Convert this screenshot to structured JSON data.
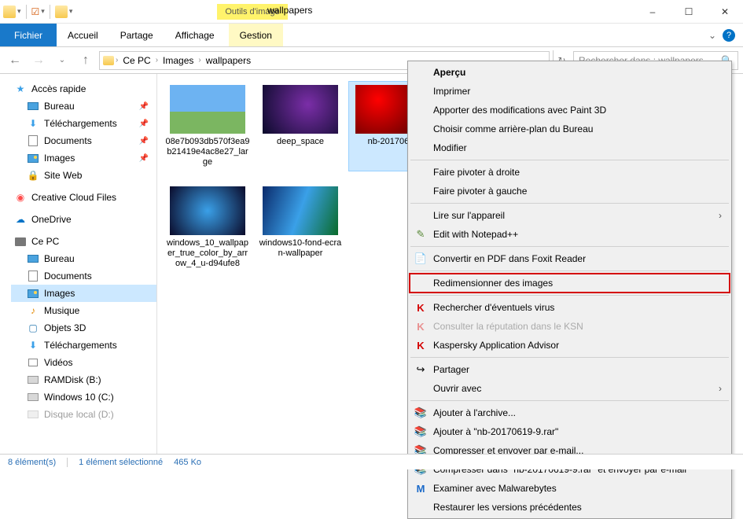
{
  "window": {
    "title": "wallpapers",
    "contextual_tab": "Outils d'image",
    "minimize": "–",
    "maximize": "☐",
    "close": "✕"
  },
  "ribbon": {
    "file": "Fichier",
    "home": "Accueil",
    "share": "Partage",
    "view": "Affichage",
    "manage": "Gestion"
  },
  "address": {
    "root": "Ce PC",
    "seg1": "Images",
    "seg2": "wallpapers"
  },
  "search": {
    "placeholder": "Rechercher dans : wallpapers"
  },
  "nav": {
    "quick": "Accès rapide",
    "desktop": "Bureau",
    "downloads": "Téléchargements",
    "documents": "Documents",
    "images": "Images",
    "siteweb": "Site Web",
    "cc": "Creative Cloud Files",
    "onedrive": "OneDrive",
    "cepc": "Ce PC",
    "pc_desktop": "Bureau",
    "pc_documents": "Documents",
    "pc_images": "Images",
    "pc_music": "Musique",
    "pc_objects": "Objets 3D",
    "pc_downloads": "Téléchargements",
    "pc_videos": "Vidéos",
    "pc_ramdisk": "RAMDisk (B:)",
    "pc_win10": "Windows 10 (C:)",
    "pc_local": "Disque local (D:)"
  },
  "files": {
    "f0": "08e7b093db570f3ea9b21419e4ac8e27_large",
    "f1": "deep_space",
    "f2": "nb-20170619",
    "f3": "windows_10_wallpaper_true_color_by_arrow_4_u-d94ufe8",
    "f4": "windows10-fond-ecran-wallpaper"
  },
  "menu": {
    "preview": "Aperçu",
    "print": "Imprimer",
    "paint3d": "Apporter des modifications avec Paint 3D",
    "setwall": "Choisir comme arrière-plan du Bureau",
    "modify": "Modifier",
    "rotr": "Faire pivoter à droite",
    "rotl": "Faire pivoter à gauche",
    "readdev": "Lire sur l'appareil",
    "npp": "Edit with Notepad++",
    "foxit": "Convertir en PDF dans Foxit Reader",
    "resize": "Redimensionner des images",
    "virus": "Rechercher d'éventuels virus",
    "ksn": "Consulter la réputation dans le KSN",
    "kav": "Kaspersky Application Advisor",
    "share": "Partager",
    "openwith": "Ouvrir avec",
    "addarchive": "Ajouter à l'archive...",
    "addrar": "Ajouter à \"nb-20170619-9.rar\"",
    "compmail": "Compresser et envoyer par e-mail...",
    "comprarmail": "Compresser dans \"nb-20170619-9.rar\" et envoyer par e-mail",
    "mwb": "Examiner avec Malwarebytes",
    "restore": "Restaurer les versions précédentes"
  },
  "status": {
    "count": "8 élément(s)",
    "sel": "1 élément sélectionné",
    "size": "465 Ko"
  }
}
